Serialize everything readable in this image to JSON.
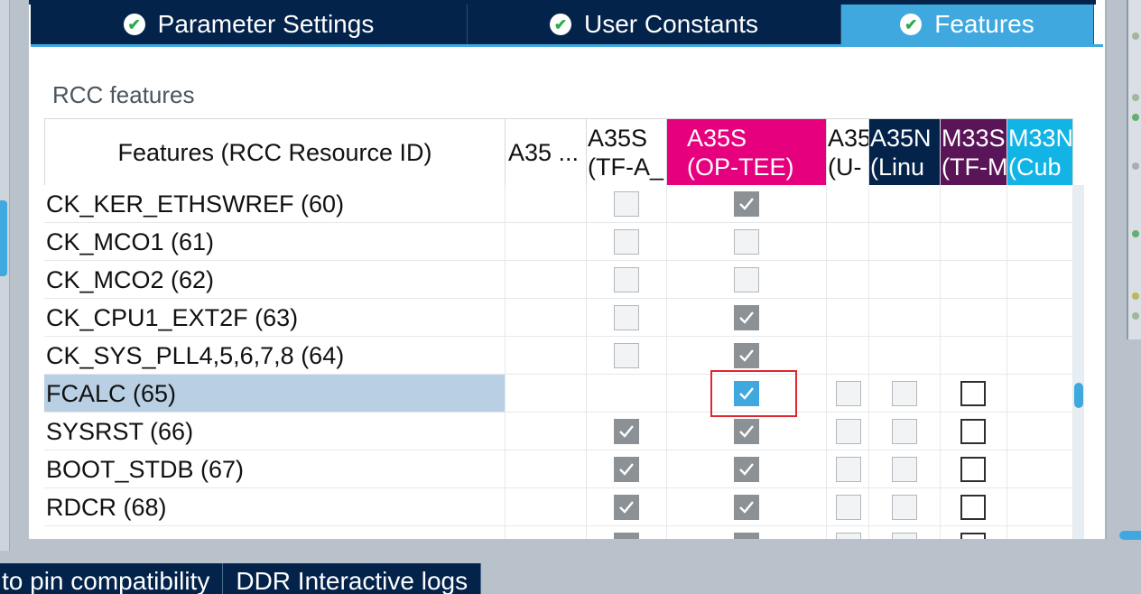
{
  "tabs": [
    {
      "label": "Parameter Settings",
      "active": false
    },
    {
      "label": "User Constants",
      "active": false
    },
    {
      "label": "Features",
      "active": true
    }
  ],
  "section_title": "RCC features",
  "table": {
    "columns": [
      {
        "line1": "Features (RCC Resource ID)",
        "line2": "",
        "bg": "#ffffff",
        "fg": "#111111"
      },
      {
        "line1": "A35 ...",
        "line2": "",
        "bg": "#ffffff",
        "fg": "#111111"
      },
      {
        "line1": "A35S",
        "line2": "(TF-A_",
        "bg": "#ffffff",
        "fg": "#111111"
      },
      {
        "line1": "A35S",
        "line2": "(OP-TEE)",
        "bg": "#e6007e",
        "fg": "#ffffff"
      },
      {
        "line1": "A35",
        "line2": "(U-",
        "bg": "#ffffff",
        "fg": "#111111"
      },
      {
        "line1": "A35N",
        "line2": "(Linu",
        "bg": "#03234b",
        "fg": "#ffffff"
      },
      {
        "line1": "M33S",
        "line2": "(TF-M",
        "bg": "#5a1458",
        "fg": "#ffffff"
      },
      {
        "line1": "M33N",
        "line2": "(Cub",
        "bg": "#11b4e4",
        "fg": "#ffffff"
      }
    ],
    "rows": [
      {
        "name": "CK_KER_ETHSWREF (60)",
        "selected": false,
        "cells": [
          "none",
          "gray-unchecked",
          "gray-checked",
          "none",
          "none",
          "none",
          "none"
        ]
      },
      {
        "name": "CK_MCO1 (61)",
        "selected": false,
        "cells": [
          "none",
          "gray-unchecked",
          "gray-unchecked",
          "none",
          "none",
          "none",
          "none"
        ]
      },
      {
        "name": "CK_MCO2 (62)",
        "selected": false,
        "cells": [
          "none",
          "gray-unchecked",
          "gray-unchecked",
          "none",
          "none",
          "none",
          "none"
        ]
      },
      {
        "name": "CK_CPU1_EXT2F (63)",
        "selected": false,
        "cells": [
          "none",
          "gray-unchecked",
          "gray-checked",
          "none",
          "none",
          "none",
          "none"
        ]
      },
      {
        "name": "CK_SYS_PLL4,5,6,7,8 (64)",
        "selected": false,
        "cells": [
          "none",
          "gray-unchecked",
          "gray-checked",
          "none",
          "none",
          "none",
          "none"
        ]
      },
      {
        "name": "FCALC (65)",
        "selected": true,
        "cells": [
          "none",
          "none",
          "blue-checked",
          "gray-unchecked",
          "gray-unchecked",
          "white-unchecked",
          "none"
        ]
      },
      {
        "name": "SYSRST (66)",
        "selected": false,
        "cells": [
          "none",
          "gray-checked",
          "gray-checked",
          "gray-unchecked",
          "gray-unchecked",
          "white-unchecked",
          "none"
        ]
      },
      {
        "name": "BOOT_STDB (67)",
        "selected": false,
        "cells": [
          "none",
          "gray-checked",
          "gray-checked",
          "gray-unchecked",
          "gray-unchecked",
          "white-unchecked",
          "none"
        ]
      },
      {
        "name": "RDCR (68)",
        "selected": false,
        "cells": [
          "none",
          "gray-checked",
          "gray-checked",
          "gray-unchecked",
          "gray-unchecked",
          "white-unchecked",
          "none"
        ]
      },
      {
        "name": "",
        "selected": false,
        "cells": [
          "none",
          "gray-checked",
          "gray-checked",
          "gray-unchecked",
          "gray-unchecked",
          "white-unchecked",
          "none"
        ]
      }
    ]
  },
  "bottom_tabs": [
    {
      "label": "to pin compatibility"
    },
    {
      "label": "DDR Interactive logs"
    }
  ],
  "colors": {
    "navy": "#03234b",
    "accent_blue": "#3fa9df",
    "magenta": "#e6007e",
    "purple": "#5a1458",
    "cyan": "#11b4e4",
    "selected_row": "#b9cfe4",
    "focus_red": "#e0262e"
  }
}
